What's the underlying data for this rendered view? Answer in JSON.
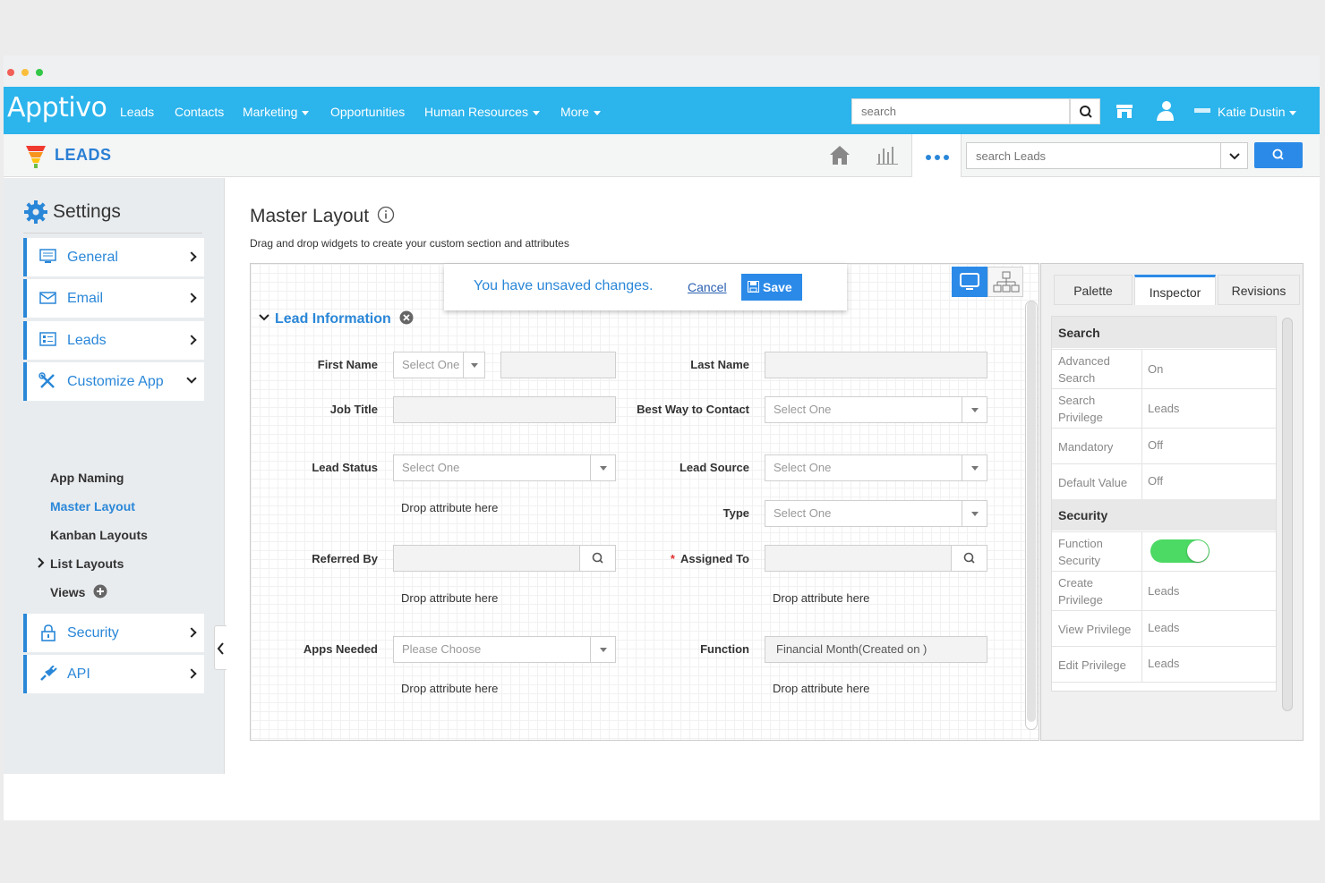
{
  "nav": {
    "logo": "Apptivo",
    "items": [
      "Leads",
      "Contacts",
      "Marketing",
      "Opportunities",
      "Human Resources",
      "More"
    ],
    "search_placeholder": "search",
    "user": "Katie Dustin"
  },
  "app": {
    "title": "LEADS",
    "search_placeholder": "search Leads"
  },
  "sidebar": {
    "title": "Settings",
    "menu": [
      "General",
      "Email",
      "Leads",
      "Customize App",
      "Security",
      "API"
    ],
    "subitems": [
      "App Naming",
      "Master Layout",
      "Kanban Layouts",
      "List Layouts",
      "Views"
    ]
  },
  "main": {
    "title": "Master Layout",
    "description": "Drag and drop widgets to create your custom section and attributes",
    "banner": {
      "message": "You have unsaved changes.",
      "cancel": "Cancel",
      "save": "Save"
    },
    "section": "Lead Information",
    "drop_label": "Drop attribute here",
    "fields": {
      "first_name": "First Name",
      "first_name_select": "Select One",
      "last_name": "Last Name",
      "job_title": "Job Title",
      "best_way": "Best Way to Contact",
      "best_way_select": "Select One",
      "lead_status": "Lead Status",
      "lead_status_select": "Select One",
      "lead_source": "Lead Source",
      "lead_source_select": "Select One",
      "type": "Type",
      "type_select": "Select One",
      "referred_by": "Referred By",
      "assigned_to": "Assigned To",
      "apps_needed": "Apps Needed",
      "apps_needed_select": "Please Choose",
      "function": "Function",
      "function_value": "Financial Month(Created on )"
    }
  },
  "inspector": {
    "tabs": [
      "Palette",
      "Inspector",
      "Revisions"
    ],
    "search_header": "Search",
    "security_header": "Security",
    "rows": {
      "adv_search_k": "Advanced Search",
      "adv_search_v": "On",
      "search_priv_k": "Search Privilege",
      "search_priv_v": "Leads",
      "mandatory_k": "Mandatory",
      "mandatory_v": "Off",
      "default_k": "Default Value",
      "default_v": "Off",
      "func_sec_k": "Function Security",
      "func_sec_on": true,
      "create_k": "Create Privilege",
      "create_v": "Leads",
      "view_k": "View Privilege",
      "view_v": "Leads",
      "edit_k": "Edit Privilege",
      "edit_v": "Leads"
    }
  },
  "colors": {
    "nav_bg": "#2cb4ec",
    "accent": "#2a87d8",
    "button": "#2b8ae8",
    "toggle_on": "#4cd964"
  }
}
